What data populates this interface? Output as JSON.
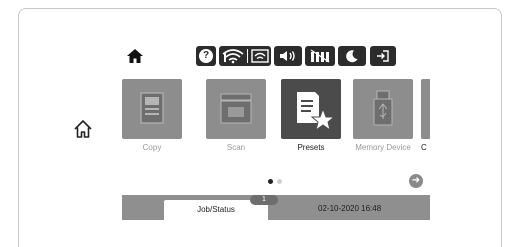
{
  "home_hardware_icon": "home-outline-icon",
  "status_bar": {
    "icons": [
      "home-icon",
      "help-icon",
      "wifi-icon",
      "wifi-direct-icon",
      "volume-icon",
      "ink-icon",
      "sleep-icon",
      "sign-in-icon"
    ],
    "help_glyph": "?"
  },
  "apps": [
    {
      "label": "Copy",
      "icon": "copy-icon",
      "selected": false
    },
    {
      "label": "Scan",
      "icon": "scan-icon",
      "selected": false
    },
    {
      "label": "Presets",
      "icon": "presets-star-icon",
      "selected": true
    },
    {
      "label": "Memory Device",
      "icon": "usb-memory-icon",
      "selected": false
    },
    {
      "label": "C",
      "icon": "partial-app-icon",
      "selected": false
    }
  ],
  "pager": {
    "pages": 2,
    "current": 1
  },
  "bottom_bar": {
    "job_status_label": "Job/Status",
    "job_count": "1",
    "datetime": "02-10-2020 16:48"
  },
  "colors": {
    "tile_inactive": "#8d8d8d",
    "tile_active": "#4b4b4b",
    "status_icon_bg": "#2c2c2c",
    "bottom_bar": "#8f8f8f"
  }
}
